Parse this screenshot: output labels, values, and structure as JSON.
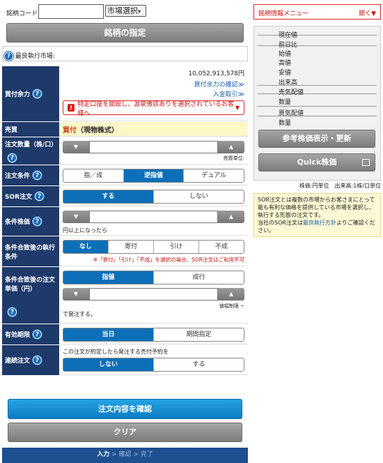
{
  "header": {
    "code_label": "銘柄コード",
    "code_value": "",
    "market_select": "市場選択",
    "specify_button": "銘柄の指定",
    "best_market_label": "最良執行市場:"
  },
  "form": {
    "buying_power": {
      "label": "買付余力",
      "amount": "10,052,913,578円",
      "confirm_link": "買付余力の確認≫",
      "deposit_link": "入金取引≫",
      "warning": "特定口座を開設し、源泉徴収ありを選択されているお客様へ"
    },
    "trade": {
      "label": "売買",
      "value_main": "買付",
      "value_sub": "（現物株式）"
    },
    "quantity": {
      "label": "注文数量（株/口）",
      "unit_note": "売買単位:"
    },
    "order_condition": {
      "label": "注文条件",
      "options": [
        "指／成",
        "逆指値",
        "デュアル"
      ],
      "selected": "逆指値"
    },
    "sor": {
      "label": "SOR注文",
      "options": [
        "する",
        "しない"
      ],
      "selected": "する"
    },
    "trigger_price": {
      "label": "条件株価",
      "suffix": "円以上になったら"
    },
    "exec_condition": {
      "label": "条件合致後の執行条件",
      "options": [
        "なし",
        "寄付",
        "引け",
        "不成"
      ],
      "selected": "なし",
      "note": "※「寄付」「引け」「不成」を選択の場合、SOR注文はご利用不可"
    },
    "order_price": {
      "label": "条件合致後の注文単価（円）",
      "options": [
        "指値",
        "成行"
      ],
      "selected": "指値",
      "range_note": "値幅制限 ~",
      "suffix": "で発注する。"
    },
    "expiry": {
      "label": "有効期限",
      "options": [
        "当日",
        "期間指定"
      ],
      "selected": "当日"
    },
    "linked": {
      "label": "連続注文",
      "text": "この注文が約定したら発注する売付予約を",
      "options": [
        "しない",
        "する"
      ],
      "selected": "しない"
    }
  },
  "actions": {
    "confirm": "注文内容を確認",
    "clear": "クリア",
    "steps": [
      "入力",
      "確認",
      "完了"
    ],
    "step_sep": " > "
  },
  "side": {
    "menu_label": "銘柄情報メニュー",
    "menu_open": "開く▼",
    "quote_rows": [
      "現在値",
      "前日比",
      "始値",
      "高値",
      "安値",
      "出来高",
      "売気配値",
      "数量",
      "買気配値",
      "数量"
    ],
    "ref_button": "参考株価表示・更新",
    "quick_button": "Quick株価",
    "units": "株価:円単位　出来高:1株/口単位",
    "sor_note_1": "SOR注文とは複数の市場からお客さまにとって最も有利な価格を提供している市場を選択し、執行する形態の注文です。",
    "sor_note_2": "当社のSOR注文は",
    "sor_note_link": "最良執行方針",
    "sor_note_3": "よりご確認ください。"
  },
  "colors": {
    "navy": "#1e3a6a",
    "blue": "#0d6fb8",
    "red": "#d22222",
    "note_bg": "#fff8d4"
  }
}
